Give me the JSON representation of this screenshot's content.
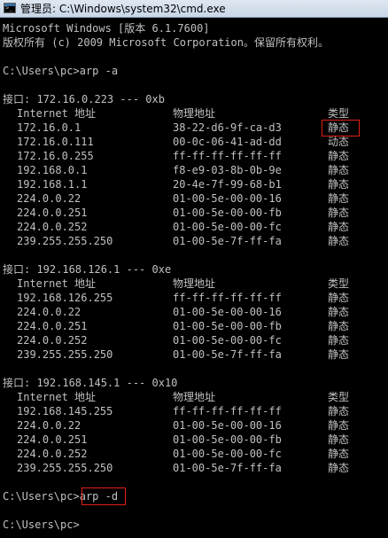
{
  "window": {
    "title": "管理员: C:\\Windows\\system32\\cmd.exe"
  },
  "header": {
    "version_line": "Microsoft Windows [版本 6.1.7600]",
    "copyright_line": "版权所有 (c) 2009 Microsoft Corporation。保留所有权利。"
  },
  "commands": {
    "arp_a": "C:\\Users\\pc>arp -a",
    "arp_d_prompt": "C:\\Users\\pc>",
    "arp_d_cmd": "arp -d",
    "final_prompt": "C:\\Users\\pc>"
  },
  "interfaces": [
    {
      "header": "接口: 172.16.0.223 --- 0xb",
      "col_ip": "Internet 地址",
      "col_mac": "物理地址",
      "col_type": "类型",
      "rows": [
        {
          "ip": "172.16.0.1",
          "mac": "38-22-d6-9f-ca-d3",
          "type": "静态"
        },
        {
          "ip": "172.16.0.111",
          "mac": "00-0c-06-41-ad-dd",
          "type": "动态"
        },
        {
          "ip": "172.16.0.255",
          "mac": "ff-ff-ff-ff-ff-ff",
          "type": "静态"
        },
        {
          "ip": "192.168.0.1",
          "mac": "f8-e9-03-8b-0b-9e",
          "type": "静态"
        },
        {
          "ip": "192.168.1.1",
          "mac": "20-4e-7f-99-68-b1",
          "type": "静态"
        },
        {
          "ip": "224.0.0.22",
          "mac": "01-00-5e-00-00-16",
          "type": "静态"
        },
        {
          "ip": "224.0.0.251",
          "mac": "01-00-5e-00-00-fb",
          "type": "静态"
        },
        {
          "ip": "224.0.0.252",
          "mac": "01-00-5e-00-00-fc",
          "type": "静态"
        },
        {
          "ip": "239.255.255.250",
          "mac": "01-00-5e-7f-ff-fa",
          "type": "静态"
        }
      ]
    },
    {
      "header": "接口: 192.168.126.1 --- 0xe",
      "col_ip": "Internet 地址",
      "col_mac": "物理地址",
      "col_type": "类型",
      "rows": [
        {
          "ip": "192.168.126.255",
          "mac": "ff-ff-ff-ff-ff-ff",
          "type": "静态"
        },
        {
          "ip": "224.0.0.22",
          "mac": "01-00-5e-00-00-16",
          "type": "静态"
        },
        {
          "ip": "224.0.0.251",
          "mac": "01-00-5e-00-00-fb",
          "type": "静态"
        },
        {
          "ip": "224.0.0.252",
          "mac": "01-00-5e-00-00-fc",
          "type": "静态"
        },
        {
          "ip": "239.255.255.250",
          "mac": "01-00-5e-7f-ff-fa",
          "type": "静态"
        }
      ]
    },
    {
      "header": "接口: 192.168.145.1 --- 0x10",
      "col_ip": "Internet 地址",
      "col_mac": "物理地址",
      "col_type": "类型",
      "rows": [
        {
          "ip": "192.168.145.255",
          "mac": "ff-ff-ff-ff-ff-ff",
          "type": "静态"
        },
        {
          "ip": "224.0.0.22",
          "mac": "01-00-5e-00-00-16",
          "type": "静态"
        },
        {
          "ip": "224.0.0.251",
          "mac": "01-00-5e-00-00-fb",
          "type": "静态"
        },
        {
          "ip": "224.0.0.252",
          "mac": "01-00-5e-00-00-fc",
          "type": "静态"
        },
        {
          "ip": "239.255.255.250",
          "mac": "01-00-5e-7f-ff-fa",
          "type": "静态"
        }
      ]
    }
  ],
  "colors": {
    "console_bg": "#000000",
    "console_fg": "#c0c0c0",
    "highlight": "#e0201a"
  },
  "icons": {
    "title": "cmd-window-icon"
  }
}
